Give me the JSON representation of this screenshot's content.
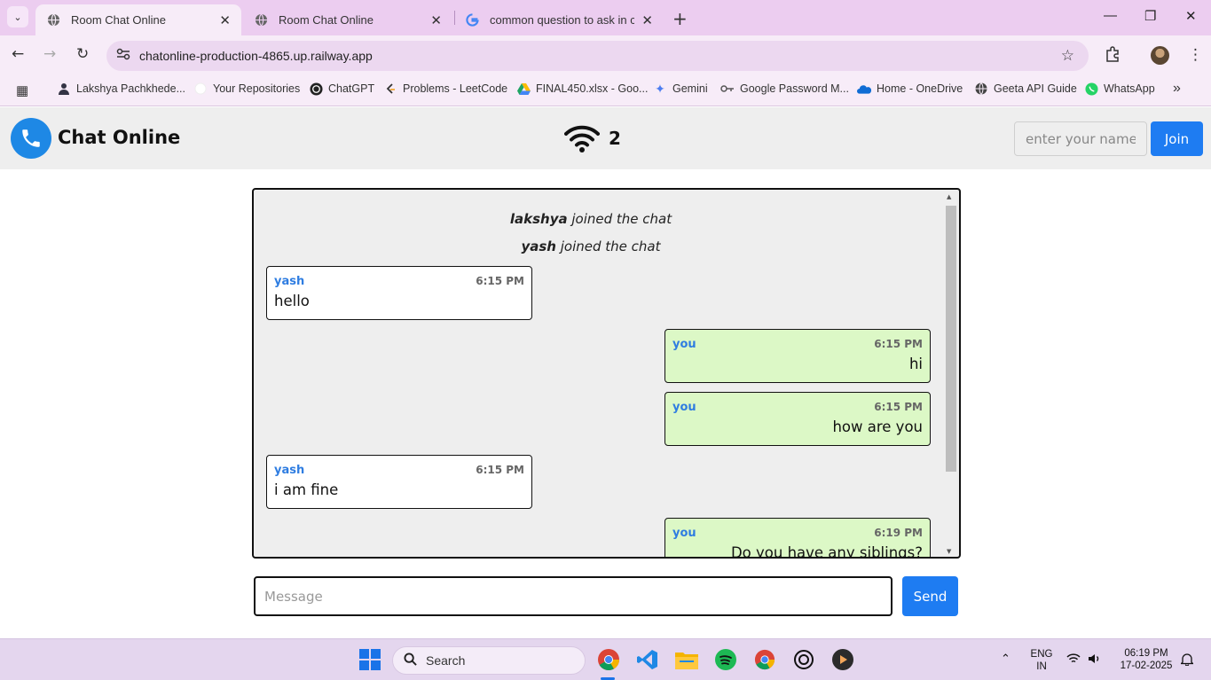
{
  "browser": {
    "tabs": [
      {
        "title": "Room Chat Online",
        "active": true
      },
      {
        "title": "Room Chat Online",
        "active": false
      },
      {
        "title": "common question to ask in cha",
        "active": false
      }
    ],
    "url": "chatonline-production-4865.up.railway.app",
    "bookmarks": [
      {
        "label": "Lakshya Pachkhede...",
        "icon": "person-icon"
      },
      {
        "label": "Your Repositories",
        "icon": "github-icon"
      },
      {
        "label": "ChatGPT",
        "icon": "chatgpt-icon"
      },
      {
        "label": "Problems - LeetCode",
        "icon": "leetcode-icon"
      },
      {
        "label": "FINAL450.xlsx - Goo...",
        "icon": "drive-icon"
      },
      {
        "label": "Gemini",
        "icon": "gemini-icon"
      },
      {
        "label": "Google Password M...",
        "icon": "key-icon"
      },
      {
        "label": "Home - OneDrive",
        "icon": "onedrive-icon"
      },
      {
        "label": "Geeta API Guide",
        "icon": "globe-icon"
      },
      {
        "label": "WhatsApp",
        "icon": "whatsapp-icon"
      }
    ]
  },
  "app": {
    "title": "Chat Online",
    "online_count": "2",
    "name_placeholder": "enter your name",
    "join_label": "Join",
    "message_placeholder": "Message",
    "send_label": "Send",
    "accent_color": "#1e7cf2",
    "own_bubble_color": "#dcf8c6"
  },
  "chat": {
    "system_messages": [
      {
        "name": "lakshya",
        "text": " joined the chat"
      },
      {
        "name": "yash",
        "text": " joined the chat"
      }
    ],
    "messages": [
      {
        "sender": "yash",
        "time": "6:15 PM",
        "text": "hello",
        "mine": false
      },
      {
        "sender": "you",
        "time": "6:15 PM",
        "text": "hi",
        "mine": true
      },
      {
        "sender": "you",
        "time": "6:15 PM",
        "text": "how are you",
        "mine": true
      },
      {
        "sender": "yash",
        "time": "6:15 PM",
        "text": "i am fine",
        "mine": false
      },
      {
        "sender": "you",
        "time": "6:19 PM",
        "text": "Do you have any siblings?",
        "mine": true
      }
    ]
  },
  "taskbar": {
    "search_label": "Search",
    "lang": "ENG",
    "region": "IN",
    "time": "06:19 PM",
    "date": "17-02-2025"
  }
}
